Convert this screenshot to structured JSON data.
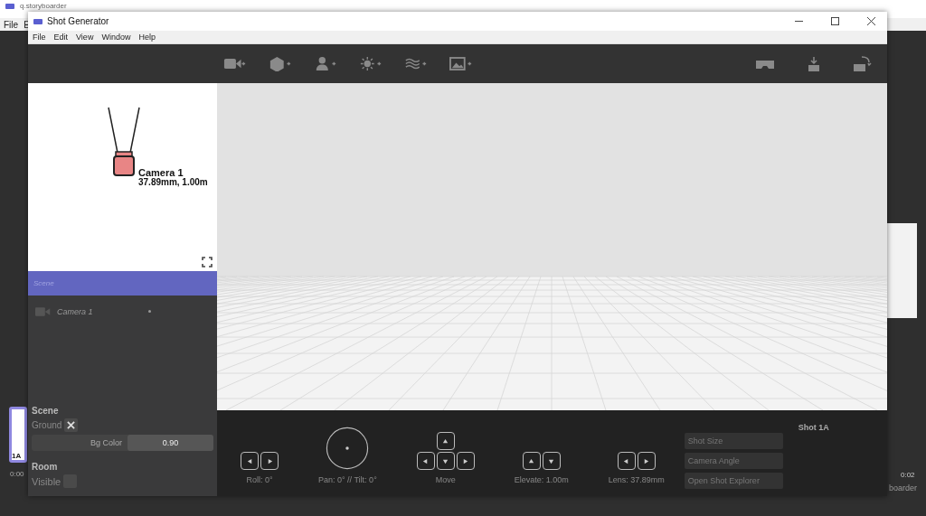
{
  "background_app": {
    "title": "q.storyboarder",
    "menu": [
      "File",
      "E"
    ],
    "thumbnail_label": "1A",
    "time_start": "0:00",
    "time_end": "0:02",
    "footer_text": "boarder"
  },
  "window": {
    "title": "Shot Generator"
  },
  "menu": [
    "File",
    "Edit",
    "View",
    "Window",
    "Help"
  ],
  "toolbar": {
    "left": [
      {
        "kind": "camera"
      },
      {
        "kind": "object"
      },
      {
        "kind": "character"
      },
      {
        "kind": "light"
      },
      {
        "kind": "volume"
      },
      {
        "kind": "image"
      }
    ],
    "right": [
      {
        "kind": "vr"
      },
      {
        "kind": "download"
      },
      {
        "kind": "transfer"
      }
    ]
  },
  "camera_view": {
    "name": "Camera 1",
    "detail": "37.89mm, 1.00m"
  },
  "scene_header": "Scene",
  "scene_items": [
    {
      "kind": "camera",
      "name": "Camera 1",
      "selected": false
    }
  ],
  "properties": {
    "scene_title": "Scene",
    "ground_label": "Ground",
    "ground_checked": true,
    "bg_color_label": "Bg Color",
    "bg_color_value": "0.90",
    "room_title": "Room",
    "visible_label": "Visible",
    "visible_checked": false
  },
  "controls": [
    {
      "kind": "pair-h",
      "label": "Roll: 0°"
    },
    {
      "kind": "dial",
      "label": "Pan: 0° // Tilt: 0°"
    },
    {
      "kind": "dpad",
      "label": "Move"
    },
    {
      "kind": "pair-v",
      "label": "Elevate: 1.00m"
    },
    {
      "kind": "pair-h",
      "label": "Lens: 37.89mm"
    }
  ],
  "shot_buttons": [
    "Shot Size",
    "Camera Angle",
    "Open Shot Explorer"
  ],
  "shot_title": "Shot 1A"
}
